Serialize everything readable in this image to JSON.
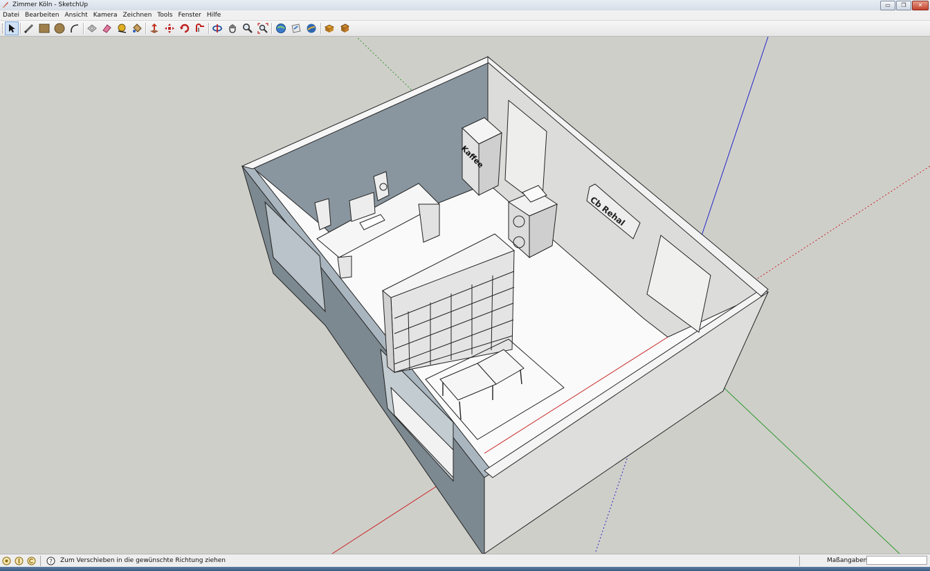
{
  "window": {
    "title": "Zimmer Köln - SketchUp",
    "minimize_glyph": "▭",
    "restore_glyph": "❐",
    "close_glyph": "✕"
  },
  "menu": {
    "items": [
      "Datei",
      "Bearbeiten",
      "Ansicht",
      "Kamera",
      "Zeichnen",
      "Tools",
      "Fenster",
      "Hilfe"
    ]
  },
  "toolbar": {
    "tools": [
      {
        "name": "select-icon"
      },
      {
        "name": "line-pencil-icon"
      },
      {
        "name": "rectangle-icon"
      },
      {
        "name": "circle-icon"
      },
      {
        "name": "arc-icon"
      },
      {
        "name": "make-component-icon"
      },
      {
        "name": "eraser-icon"
      },
      {
        "name": "tape-measure-icon"
      },
      {
        "name": "paint-bucket-icon"
      },
      {
        "name": "push-pull-icon"
      },
      {
        "name": "move-icon"
      },
      {
        "name": "rotate-icon"
      },
      {
        "name": "offset-icon"
      },
      {
        "name": "orbit-icon"
      },
      {
        "name": "pan-icon"
      },
      {
        "name": "zoom-icon"
      },
      {
        "name": "zoom-extents-icon"
      },
      {
        "name": "get-models-icon"
      },
      {
        "name": "share-model-icon"
      },
      {
        "name": "google-earth-icon"
      },
      {
        "name": "get-components-icon"
      },
      {
        "name": "extension-warehouse-icon"
      }
    ]
  },
  "model": {
    "cabinet_label": "Kaffee",
    "sign_label": "Cb Rehal"
  },
  "status": {
    "message": "Zum Verschieben in die gewünschte Richtung ziehen",
    "measurements_label": "Maßangaben",
    "measurements_value": ""
  },
  "colors": {
    "background": "#cfcfca",
    "wall_interior": "#8e9aa3",
    "wall_light": "#d9d9d7",
    "axis_red": "#d02020",
    "axis_green": "#2a9a2a",
    "axis_blue": "#2020d0"
  }
}
